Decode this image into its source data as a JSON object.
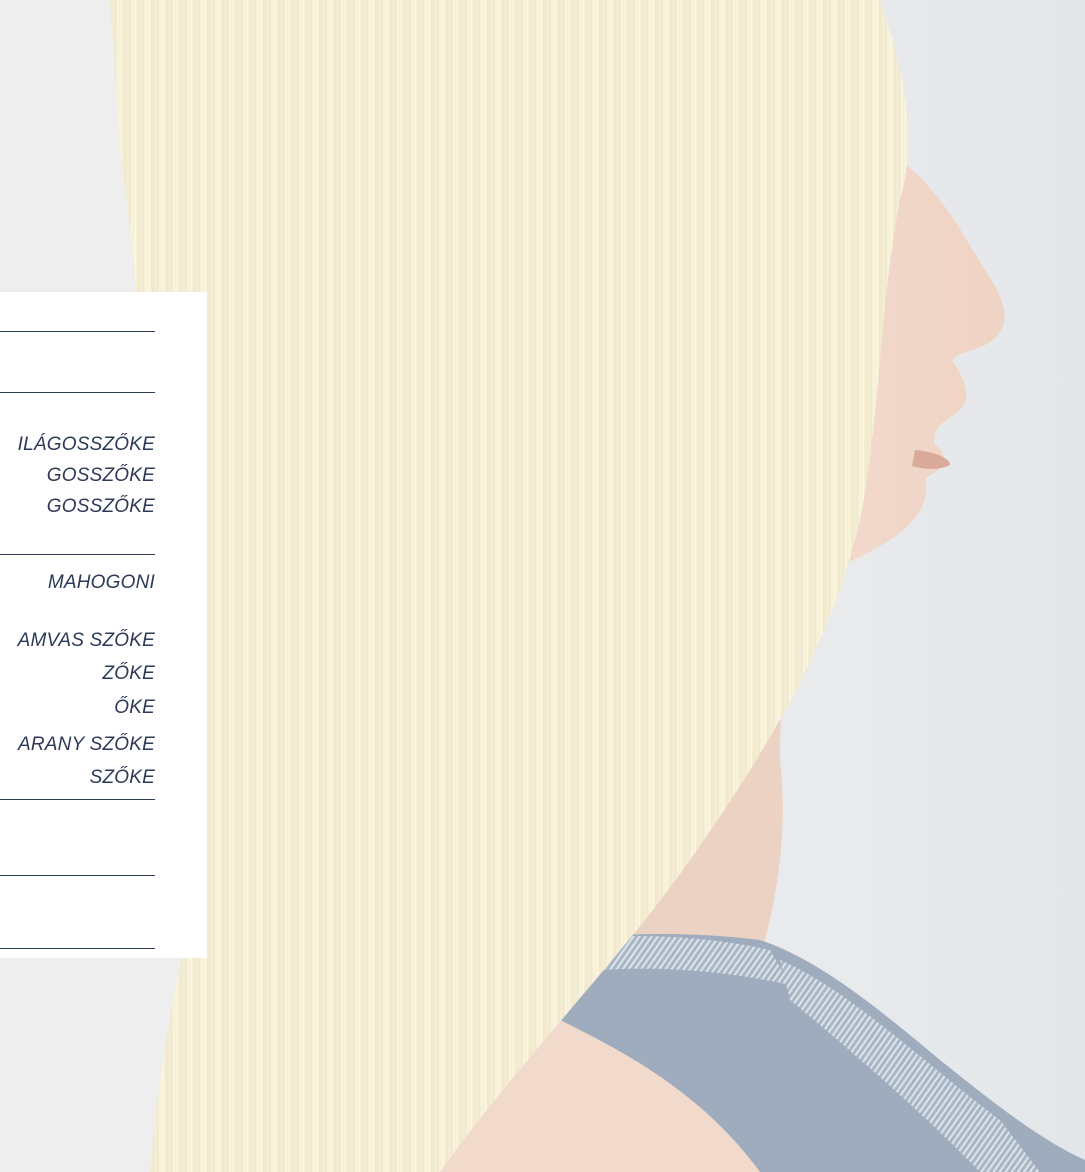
{
  "menu": {
    "group_a": [
      "ILÁGOSSZŐKE",
      "GOSSZŐKE",
      "GOSSZŐKE"
    ],
    "group_b": [
      "MAHOGONI"
    ],
    "group_c": [
      "AMVAS SZŐKE",
      "ZŐKE",
      "ŐKE",
      "ARANY SZŐKE",
      "SZŐKE"
    ]
  },
  "colors": {
    "text": "#2c3a57",
    "panel": "#ffffff",
    "background": "#e8eaec",
    "hair": "#f6f0d8",
    "shirt": "#9eacbd"
  }
}
